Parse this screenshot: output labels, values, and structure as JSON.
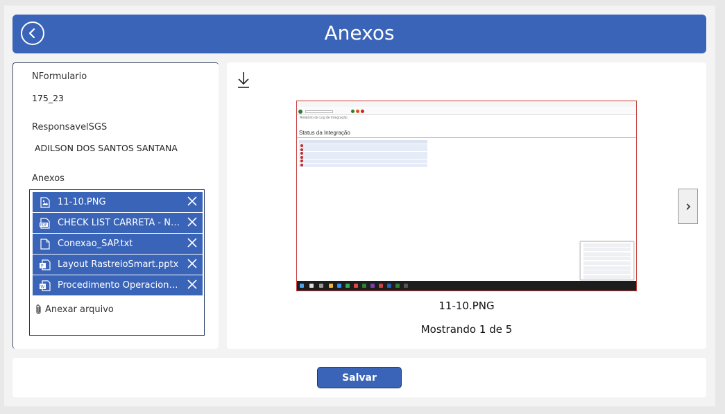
{
  "header": {
    "title": "Anexos"
  },
  "form": {
    "nformulario_label": "NFormulario",
    "nformulario_value": "175_23",
    "responsavel_label": "ResponsavelSGS",
    "responsavel_value": "ADILSON DOS SANTOS SANTANA",
    "anexos_label": "Anexos"
  },
  "attachments": [
    {
      "name": "11-10.PNG",
      "icon": "image-file-icon"
    },
    {
      "name": "CHECK LIST CARRETA - NOV...",
      "icon": "pdf-file-icon"
    },
    {
      "name": "Conexao_SAP.txt",
      "icon": "text-file-icon"
    },
    {
      "name": "Layout RastreioSmart.pptx",
      "icon": "powerpoint-file-icon"
    },
    {
      "name": "Procedimento Operacional ...",
      "icon": "word-file-icon"
    }
  ],
  "add_file_label": "Anexar arquivo",
  "viewer": {
    "current_name": "11-10.PNG",
    "counter": "Mostrando 1 de 5",
    "preview_status_title": "Status da Integração",
    "preview_report_title": "Relatório de Log de Integração"
  },
  "footer": {
    "save_label": "Salvar"
  },
  "colors": {
    "accent": "#3a64b8",
    "background": "#f3f3f3"
  }
}
